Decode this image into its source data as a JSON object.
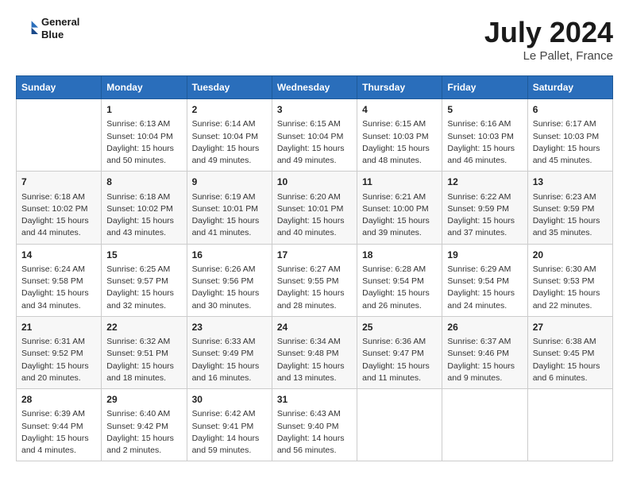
{
  "header": {
    "logo_line1": "General",
    "logo_line2": "Blue",
    "month_title": "July 2024",
    "location": "Le Pallet, France"
  },
  "calendar": {
    "days_of_week": [
      "Sunday",
      "Monday",
      "Tuesday",
      "Wednesday",
      "Thursday",
      "Friday",
      "Saturday"
    ],
    "weeks": [
      [
        {
          "day": "",
          "content": ""
        },
        {
          "day": "1",
          "content": "Sunrise: 6:13 AM\nSunset: 10:04 PM\nDaylight: 15 hours\nand 50 minutes."
        },
        {
          "day": "2",
          "content": "Sunrise: 6:14 AM\nSunset: 10:04 PM\nDaylight: 15 hours\nand 49 minutes."
        },
        {
          "day": "3",
          "content": "Sunrise: 6:15 AM\nSunset: 10:04 PM\nDaylight: 15 hours\nand 49 minutes."
        },
        {
          "day": "4",
          "content": "Sunrise: 6:15 AM\nSunset: 10:03 PM\nDaylight: 15 hours\nand 48 minutes."
        },
        {
          "day": "5",
          "content": "Sunrise: 6:16 AM\nSunset: 10:03 PM\nDaylight: 15 hours\nand 46 minutes."
        },
        {
          "day": "6",
          "content": "Sunrise: 6:17 AM\nSunset: 10:03 PM\nDaylight: 15 hours\nand 45 minutes."
        }
      ],
      [
        {
          "day": "7",
          "content": "Sunrise: 6:18 AM\nSunset: 10:02 PM\nDaylight: 15 hours\nand 44 minutes."
        },
        {
          "day": "8",
          "content": "Sunrise: 6:18 AM\nSunset: 10:02 PM\nDaylight: 15 hours\nand 43 minutes."
        },
        {
          "day": "9",
          "content": "Sunrise: 6:19 AM\nSunset: 10:01 PM\nDaylight: 15 hours\nand 41 minutes."
        },
        {
          "day": "10",
          "content": "Sunrise: 6:20 AM\nSunset: 10:01 PM\nDaylight: 15 hours\nand 40 minutes."
        },
        {
          "day": "11",
          "content": "Sunrise: 6:21 AM\nSunset: 10:00 PM\nDaylight: 15 hours\nand 39 minutes."
        },
        {
          "day": "12",
          "content": "Sunrise: 6:22 AM\nSunset: 9:59 PM\nDaylight: 15 hours\nand 37 minutes."
        },
        {
          "day": "13",
          "content": "Sunrise: 6:23 AM\nSunset: 9:59 PM\nDaylight: 15 hours\nand 35 minutes."
        }
      ],
      [
        {
          "day": "14",
          "content": "Sunrise: 6:24 AM\nSunset: 9:58 PM\nDaylight: 15 hours\nand 34 minutes."
        },
        {
          "day": "15",
          "content": "Sunrise: 6:25 AM\nSunset: 9:57 PM\nDaylight: 15 hours\nand 32 minutes."
        },
        {
          "day": "16",
          "content": "Sunrise: 6:26 AM\nSunset: 9:56 PM\nDaylight: 15 hours\nand 30 minutes."
        },
        {
          "day": "17",
          "content": "Sunrise: 6:27 AM\nSunset: 9:55 PM\nDaylight: 15 hours\nand 28 minutes."
        },
        {
          "day": "18",
          "content": "Sunrise: 6:28 AM\nSunset: 9:54 PM\nDaylight: 15 hours\nand 26 minutes."
        },
        {
          "day": "19",
          "content": "Sunrise: 6:29 AM\nSunset: 9:54 PM\nDaylight: 15 hours\nand 24 minutes."
        },
        {
          "day": "20",
          "content": "Sunrise: 6:30 AM\nSunset: 9:53 PM\nDaylight: 15 hours\nand 22 minutes."
        }
      ],
      [
        {
          "day": "21",
          "content": "Sunrise: 6:31 AM\nSunset: 9:52 PM\nDaylight: 15 hours\nand 20 minutes."
        },
        {
          "day": "22",
          "content": "Sunrise: 6:32 AM\nSunset: 9:51 PM\nDaylight: 15 hours\nand 18 minutes."
        },
        {
          "day": "23",
          "content": "Sunrise: 6:33 AM\nSunset: 9:49 PM\nDaylight: 15 hours\nand 16 minutes."
        },
        {
          "day": "24",
          "content": "Sunrise: 6:34 AM\nSunset: 9:48 PM\nDaylight: 15 hours\nand 13 minutes."
        },
        {
          "day": "25",
          "content": "Sunrise: 6:36 AM\nSunset: 9:47 PM\nDaylight: 15 hours\nand 11 minutes."
        },
        {
          "day": "26",
          "content": "Sunrise: 6:37 AM\nSunset: 9:46 PM\nDaylight: 15 hours\nand 9 minutes."
        },
        {
          "day": "27",
          "content": "Sunrise: 6:38 AM\nSunset: 9:45 PM\nDaylight: 15 hours\nand 6 minutes."
        }
      ],
      [
        {
          "day": "28",
          "content": "Sunrise: 6:39 AM\nSunset: 9:44 PM\nDaylight: 15 hours\nand 4 minutes."
        },
        {
          "day": "29",
          "content": "Sunrise: 6:40 AM\nSunset: 9:42 PM\nDaylight: 15 hours\nand 2 minutes."
        },
        {
          "day": "30",
          "content": "Sunrise: 6:42 AM\nSunset: 9:41 PM\nDaylight: 14 hours\nand 59 minutes."
        },
        {
          "day": "31",
          "content": "Sunrise: 6:43 AM\nSunset: 9:40 PM\nDaylight: 14 hours\nand 56 minutes."
        },
        {
          "day": "",
          "content": ""
        },
        {
          "day": "",
          "content": ""
        },
        {
          "day": "",
          "content": ""
        }
      ]
    ]
  }
}
